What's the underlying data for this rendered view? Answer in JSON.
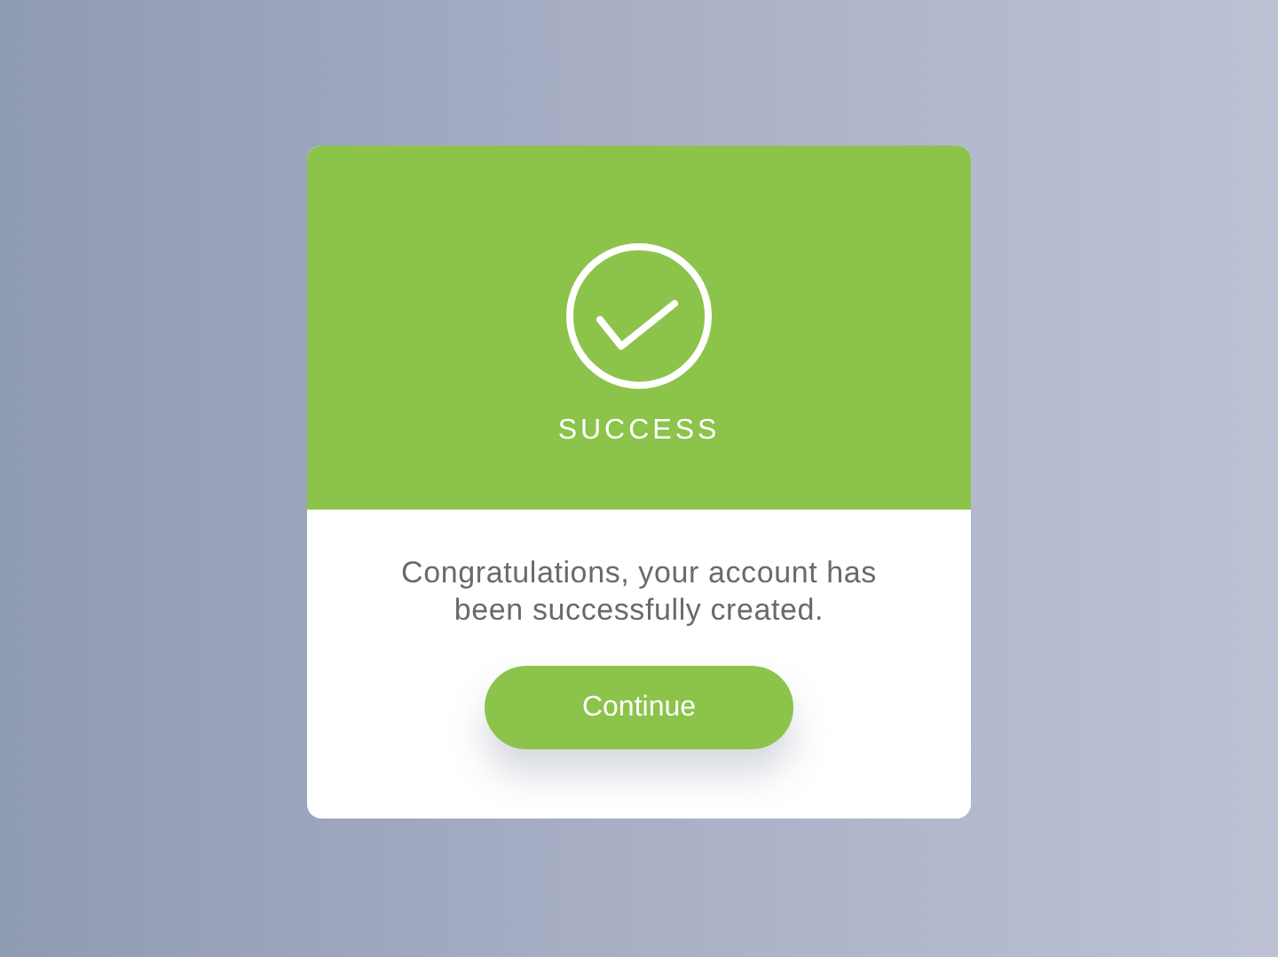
{
  "dialog": {
    "status": "SUCCESS",
    "message": "Congratulations, your account has been successfully created.",
    "button": "Continue"
  }
}
